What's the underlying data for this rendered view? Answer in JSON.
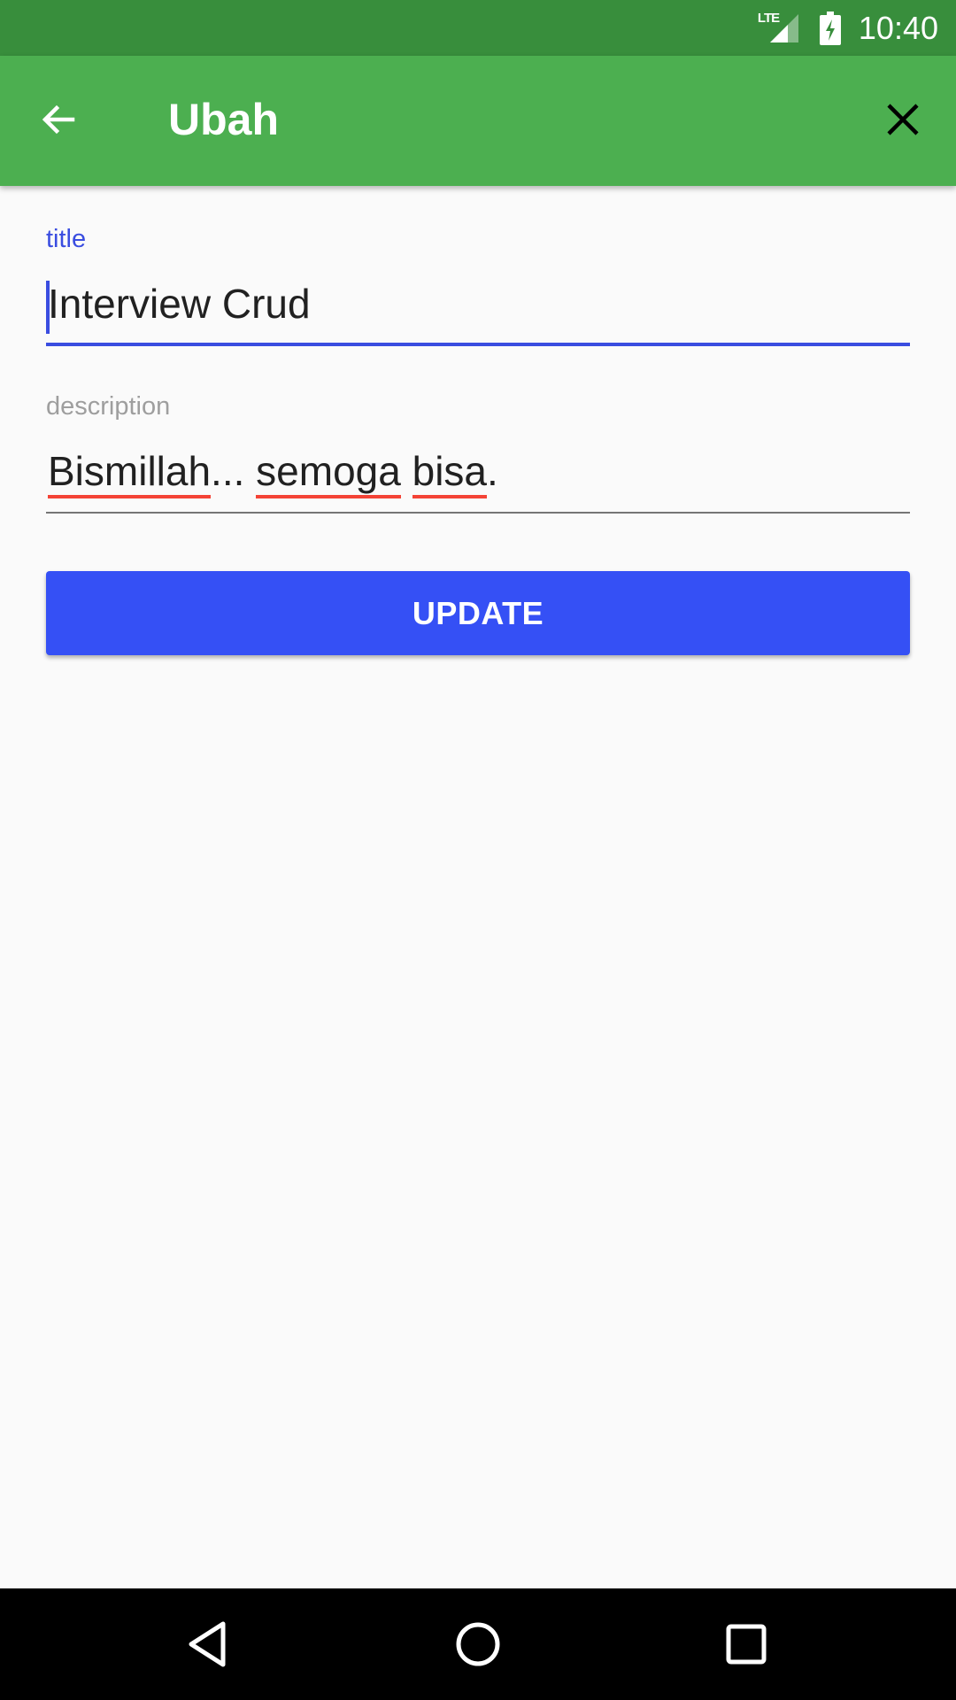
{
  "status_bar": {
    "network_label": "LTE",
    "time": "10:40"
  },
  "app_bar": {
    "title": "Ubah",
    "back_icon": "arrow-back-icon",
    "close_icon": "close-icon",
    "background": "#4caf50",
    "status_background": "#388e3c"
  },
  "form": {
    "title_field": {
      "label": "title",
      "value": "Interview Crud",
      "focused": true
    },
    "description_field": {
      "label": "description",
      "words": [
        "Bismillah",
        "...",
        " ",
        "semoga",
        " ",
        "bisa",
        "."
      ]
    },
    "update_button": {
      "label": "UPDATE",
      "color": "#3550f5"
    }
  },
  "nav_bar": {
    "back_icon": "nav-back-triangle-icon",
    "home_icon": "nav-home-circle-icon",
    "recents_icon": "nav-recents-square-icon"
  },
  "accent_color": "#3a4de0"
}
